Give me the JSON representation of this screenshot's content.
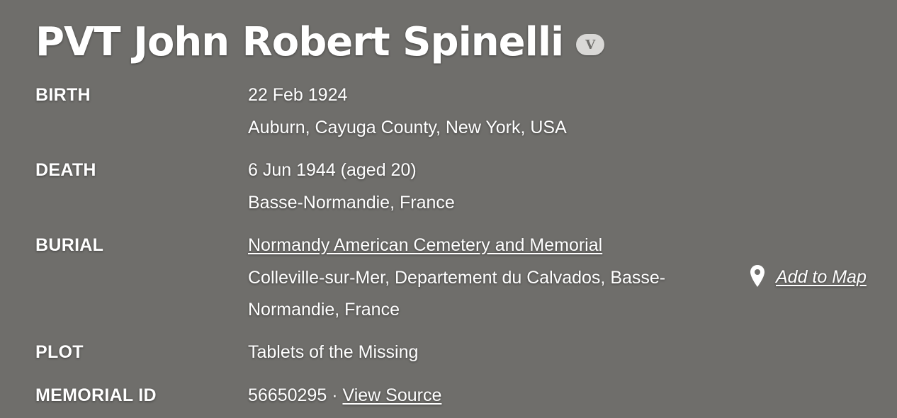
{
  "header": {
    "title": "PVT John Robert Spinelli",
    "veteran_badge": "V"
  },
  "facts": {
    "birth": {
      "label": "BIRTH",
      "date": "22 Feb 1924",
      "place": "Auburn, Cayuga County, New York, USA"
    },
    "death": {
      "label": "DEATH",
      "date": "6 Jun 1944 (aged 20)",
      "place": "Basse-Normandie, France"
    },
    "burial": {
      "label": "BURIAL",
      "cemetery": "Normandy American Cemetery and Memorial",
      "location": "Colleville-sur-Mer, Departement du Calvados, Basse-Normandie, France",
      "add_to_map": "Add to Map",
      "map_icon": "map-pin-icon"
    },
    "plot": {
      "label": "PLOT",
      "value": "Tablets of the Missing"
    },
    "memorial_id": {
      "label": "MEMORIAL ID",
      "value": "56650295",
      "separator": "·",
      "view_source": "View Source"
    }
  },
  "colors": {
    "background": "#6f6e6b",
    "text": "#ffffff",
    "badge_bg": "#d9d8d6"
  }
}
